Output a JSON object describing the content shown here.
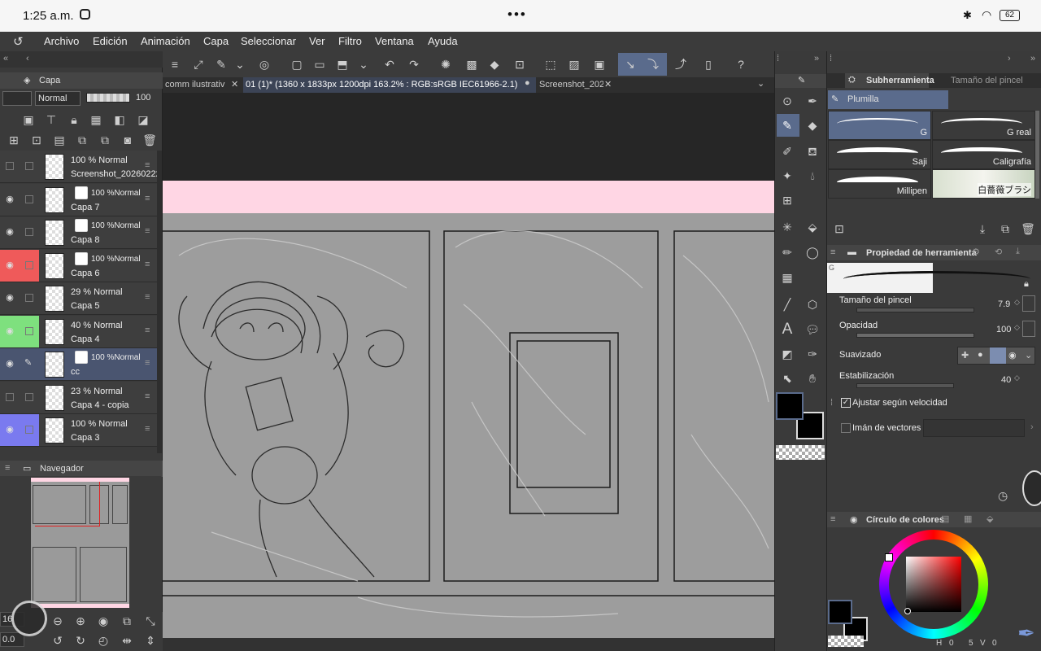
{
  "status": {
    "time": "1:25 a.m.",
    "battery": "62",
    "dots": "•••"
  },
  "menu": [
    "Archivo",
    "Edición",
    "Animación",
    "Capa",
    "Seleccionar",
    "Ver",
    "Filtro",
    "Ventana",
    "Ayuda"
  ],
  "layer_panel": {
    "title": "Capa",
    "blend_mode": "Normal",
    "opacity": "100",
    "layers": [
      {
        "pct": "100 % Normal",
        "name": "Screenshot_20260222",
        "band": ""
      },
      {
        "pct": "100 %Normal",
        "name": "Capa 7",
        "band": ""
      },
      {
        "pct": "100 %Normal",
        "name": "Capa 8",
        "band": ""
      },
      {
        "pct": "100 %Normal",
        "name": "Capa 6",
        "band": "#ef5a5a"
      },
      {
        "pct": "29 % Normal",
        "name": "Capa 5",
        "band": ""
      },
      {
        "pct": "40 % Normal",
        "name": "Capa 4",
        "band": "#7ee07e"
      },
      {
        "pct": "100 %Normal",
        "name": "cc",
        "band": ""
      },
      {
        "pct": "23 % Normal",
        "name": "Capa 4 - copia",
        "band": ""
      },
      {
        "pct": "100 % Normal",
        "name": "Capa 3",
        "band": "#7a7aef"
      }
    ]
  },
  "navigator": {
    "title": "Navegador",
    "zoom": "16",
    "angle": "0.0"
  },
  "tabs": [
    {
      "label": "comm ilustrativ"
    },
    {
      "label": "01 (1)* (1360 x 1833px 1200dpi 163.2% : RGB:sRGB IEC61966-2.1)"
    },
    {
      "label": "Screenshot_202"
    }
  ],
  "subtool": {
    "tab1": "Subherramienta",
    "tab2": "Tamaño del pincel",
    "group": "Plumilla",
    "brushes": [
      "G",
      "G real",
      "Saji",
      "Caligrafía",
      "Millipen",
      "白薔薇ブラシ"
    ]
  },
  "tool_property": {
    "title": "Propiedad de herramienta",
    "brush_size_label": "Tamaño del pincel",
    "brush_size": "7.9",
    "opacity_label": "Opacidad",
    "opacity": "100",
    "smoothing_label": "Suavizado",
    "stabilization_label": "Estabilización",
    "stabilization": "40",
    "speed_label": "Ajustar según velocidad",
    "vector_label": "Imán de vectores"
  },
  "color_panel": {
    "title": "Círculo de colores",
    "h": "0",
    "s": "5",
    "v": "0",
    "main_color": "#000000",
    "accent": "#5a6b8c"
  }
}
